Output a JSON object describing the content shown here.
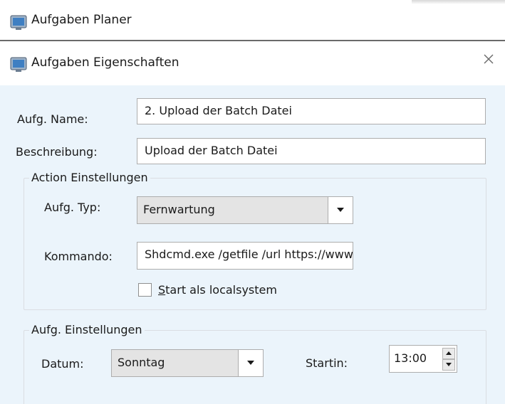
{
  "app": {
    "title": "Aufgaben Planer",
    "icon": "window-icon"
  },
  "dialog": {
    "title": "Aufgaben Eigenschaften",
    "close_glyph": "✕"
  },
  "form": {
    "name_label": "Aufg. Name:",
    "name_value": "2.  Upload der Batch Datei",
    "description_label": "Beschreibung:",
    "description_value": "Upload der Batch Datei"
  },
  "action_group": {
    "label": "Action Einstellungen",
    "type_label": "Aufg. Typ:",
    "type_value": "Fernwartung",
    "command_label": "Kommando:",
    "command_value": "Shdcmd.exe /getfile /url https://www.blackfiles",
    "localsystem_checkbox": {
      "mnemonic": "S",
      "label_rest": "tart als localsystem",
      "checked": false
    }
  },
  "task_group": {
    "label": "Aufg. Einstellungen",
    "date_label": "Datum:",
    "date_value": "Sonntag",
    "start_label": "Startin:",
    "start_value": "13:00"
  },
  "colors": {
    "dialog_background": "#ebf4fb",
    "input_border": "#adadad",
    "combo_background": "#e4e4e4"
  }
}
